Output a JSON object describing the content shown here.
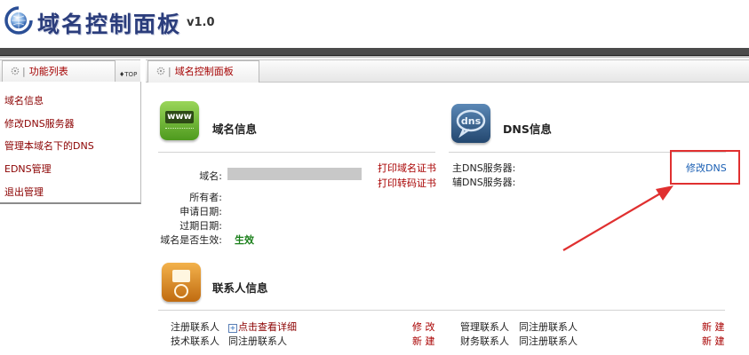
{
  "header": {
    "title": "域名控制面板",
    "version": "v1.0"
  },
  "sidebar": {
    "tab_label": "功能列表",
    "top_link": "TOP",
    "items": [
      {
        "label": "域名信息"
      },
      {
        "label": "修改DNS服务器"
      },
      {
        "label": "管理本域名下的DNS"
      },
      {
        "label": "EDNS管理"
      },
      {
        "label": "退出管理"
      }
    ]
  },
  "main": {
    "tab_label": "域名控制面板",
    "domain_info": {
      "title": "域名信息",
      "icon_text": "www",
      "fields": [
        {
          "label": "域名:",
          "value": ""
        },
        {
          "label": "所有者:",
          "value": ""
        },
        {
          "label": "申请日期:",
          "value": ""
        },
        {
          "label": "过期日期:",
          "value": ""
        },
        {
          "label": "域名是否生效:",
          "value": "生效"
        }
      ],
      "print_cert": "打印域名证书",
      "print_transfer": "打印转码证书"
    },
    "dns_info": {
      "title": "DNS信息",
      "icon_text": "dns",
      "primary_label": "主DNS服务器:",
      "secondary_label": "辅DNS服务器:",
      "modify_link": "修改DNS"
    },
    "contact_info": {
      "title": "联系人信息",
      "rows": [
        {
          "left_label": "注册联系人",
          "left_value": "点击查看详细",
          "left_action": "修 改",
          "right_label": "管理联系人",
          "right_value": "同注册联系人",
          "right_action": "新 建"
        },
        {
          "left_label": "技术联系人",
          "left_value": "同注册联系人",
          "left_action": "新 建",
          "right_label": "财务联系人",
          "right_value": "同注册联系人",
          "right_action": "新 建"
        }
      ]
    }
  },
  "colors": {
    "accent_red": "#a80000",
    "link_blue": "#1a5fb4",
    "status_green": "#1a7f1a",
    "annotation_red": "#e03030"
  }
}
